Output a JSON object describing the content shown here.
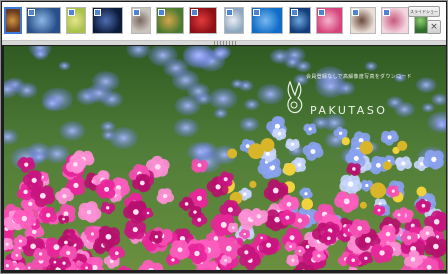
{
  "viewer": {
    "slideshow_label": "スライドショー",
    "close_symbol": "×",
    "prev_arrow": "◀",
    "next_arrow": "▶"
  },
  "thumbnails": [
    {
      "name": "flower-macro",
      "active": true,
      "colors": [
        "#6a3b1e",
        "#d0943e"
      ]
    },
    {
      "name": "blue-petals",
      "active": false,
      "colors": [
        "#284f8a",
        "#8cb7e5"
      ]
    },
    {
      "name": "yellow-green",
      "active": false,
      "colors": [
        "#a8c24a",
        "#e7e58d"
      ]
    },
    {
      "name": "dark-blue-flower",
      "active": false,
      "colors": [
        "#0d1b3b",
        "#4e6fb3"
      ]
    },
    {
      "name": "portrait",
      "active": false,
      "colors": [
        "#c9c4bd",
        "#7a6a62"
      ]
    },
    {
      "name": "garden",
      "active": false,
      "colors": [
        "#4a7a30",
        "#d7a54a"
      ]
    },
    {
      "name": "red-rose",
      "active": false,
      "colors": [
        "#8d1016",
        "#e23b3b"
      ]
    },
    {
      "name": "bottle",
      "active": false,
      "colors": [
        "#8fa8c2",
        "#e9eef4"
      ]
    },
    {
      "name": "blue-sky",
      "active": false,
      "colors": [
        "#0f6cc8",
        "#79b8ee"
      ]
    },
    {
      "name": "blue-wave",
      "active": false,
      "colors": [
        "#123d7a",
        "#6fa6dd"
      ]
    },
    {
      "name": "pink-rose",
      "active": false,
      "colors": [
        "#d6447b",
        "#f6b3cb"
      ]
    },
    {
      "name": "woman",
      "active": false,
      "colors": [
        "#e9dfd6",
        "#6b4a3e"
      ]
    },
    {
      "name": "pink-flower",
      "active": false,
      "colors": [
        "#f2d5df",
        "#c9577e"
      ]
    },
    {
      "name": "green-leaf",
      "active": false,
      "colors": [
        "#2f6e2a",
        "#8fcf6e"
      ]
    }
  ],
  "photo": {
    "name": "nemophila-and-pink-flowers",
    "watermark_tagline": "会員登録なしで高解像度写真をダウンロード",
    "watermark_name": "PAKUTASO",
    "colors": {
      "sky_green": "#3e6b2e",
      "blue_flower": "#6f86e0",
      "pink_flower": "#e4319e",
      "yellow_flower": "#e0c23a"
    }
  }
}
